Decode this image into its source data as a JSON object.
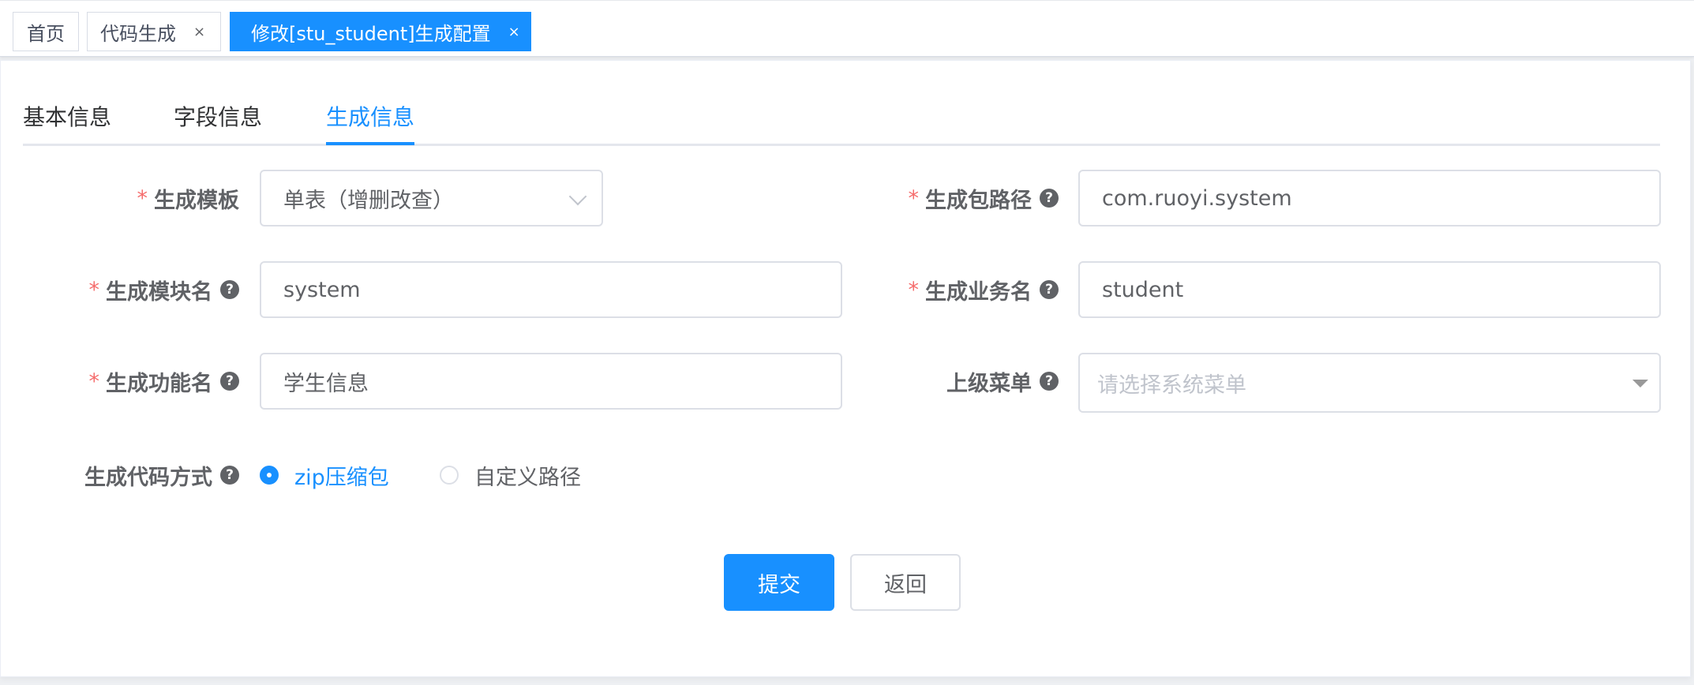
{
  "tags": [
    {
      "label": "首页"
    },
    {
      "label": "代码生成",
      "close": "×"
    },
    {
      "label": "修改[stu_student]生成配置",
      "close": "×"
    }
  ],
  "tabs": [
    {
      "label": "基本信息"
    },
    {
      "label": "字段信息"
    },
    {
      "label": "生成信息"
    }
  ],
  "form": {
    "required_mark": "*",
    "help_glyph": "?",
    "template": {
      "label": "生成模板",
      "value": "单表（增删改查）"
    },
    "package_path": {
      "label": "生成包路径",
      "value": "com.ruoyi.system"
    },
    "module_name": {
      "label": "生成模块名",
      "value": "system"
    },
    "business_name": {
      "label": "生成业务名",
      "value": "student"
    },
    "function_name": {
      "label": "生成功能名",
      "value": "学生信息"
    },
    "parent_menu": {
      "label": "上级菜单",
      "placeholder": "请选择系统菜单"
    },
    "gen_type": {
      "label": "生成代码方式",
      "options": [
        "zip压缩包",
        "自定义路径"
      ],
      "selected": "zip压缩包"
    }
  },
  "buttons": {
    "submit": "提交",
    "back": "返回"
  },
  "colors": {
    "primary": "#1890ff",
    "required": "#f56c6c"
  }
}
